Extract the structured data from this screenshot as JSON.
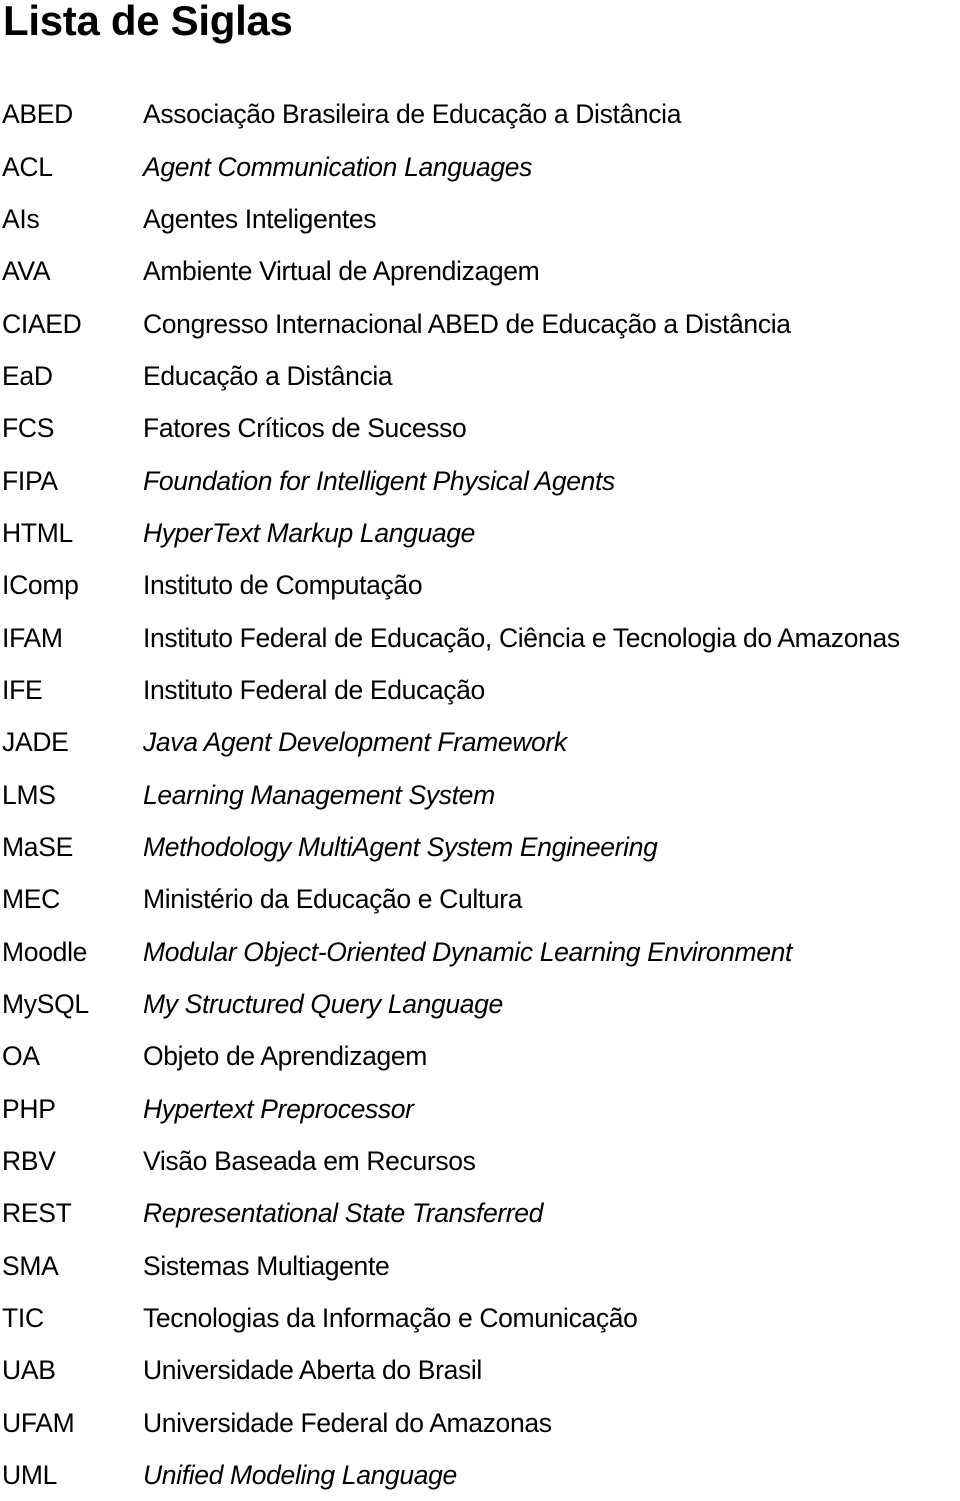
{
  "title": "Lista de Siglas",
  "entries": [
    {
      "abbr": "ABED",
      "definition": "Associação Brasileira de Educação a Distância",
      "italic": false
    },
    {
      "abbr": "ACL",
      "definition": "Agent Communication Languages",
      "italic": true
    },
    {
      "abbr": "AIs",
      "definition": "Agentes Inteligentes",
      "italic": false
    },
    {
      "abbr": "AVA",
      "definition": "Ambiente Virtual de Aprendizagem",
      "italic": false
    },
    {
      "abbr": "CIAED",
      "definition": "Congresso Internacional ABED de Educação a Distância",
      "italic": false
    },
    {
      "abbr": "EaD",
      "definition": "Educação a Distância",
      "italic": false
    },
    {
      "abbr": "FCS",
      "definition": "Fatores Críticos de Sucesso",
      "italic": false
    },
    {
      "abbr": "FIPA",
      "definition": "Foundation for Intelligent Physical Agents",
      "italic": true
    },
    {
      "abbr": "HTML",
      "definition": "HyperText Markup Language",
      "italic": true
    },
    {
      "abbr": "IComp",
      "definition": "Instituto de Computação",
      "italic": false
    },
    {
      "abbr": "IFAM",
      "definition": "Instituto Federal de Educação, Ciência e Tecnologia do Amazonas",
      "italic": false
    },
    {
      "abbr": "IFE",
      "definition": "Instituto Federal de Educação",
      "italic": false
    },
    {
      "abbr": "JADE",
      "definition": "Java Agent Development Framework",
      "italic": true
    },
    {
      "abbr": "LMS",
      "definition": "Learning Management System",
      "italic": true
    },
    {
      "abbr": "MaSE",
      "definition": "Methodology MultiAgent System Engineering",
      "italic": true
    },
    {
      "abbr": "MEC",
      "definition": "Ministério da Educação e Cultura",
      "italic": false
    },
    {
      "abbr": "Moodle",
      "definition": "Modular Object-Oriented Dynamic Learning Environment",
      "italic": true
    },
    {
      "abbr": "MySQL",
      "definition": "My Structured Query Language",
      "italic": true
    },
    {
      "abbr": "OA",
      "definition": "Objeto de Aprendizagem",
      "italic": false
    },
    {
      "abbr": "PHP",
      "definition": "Hypertext Preprocessor",
      "italic": true
    },
    {
      "abbr": "RBV",
      "definition": "Visão Baseada em Recursos",
      "italic": false
    },
    {
      "abbr": "REST",
      "definition": "Representational State Transferred",
      "italic": true
    },
    {
      "abbr": "SMA",
      "definition": "Sistemas Multiagente",
      "italic": false
    },
    {
      "abbr": "TIC",
      "definition": "Tecnologias da Informação e Comunicação",
      "italic": false
    },
    {
      "abbr": "UAB",
      "definition": "Universidade Aberta do Brasil",
      "italic": false
    },
    {
      "abbr": "UFAM",
      "definition": "Universidade Federal do Amazonas",
      "italic": false
    },
    {
      "abbr": "UML",
      "definition": "Unified Modeling Language",
      "italic": true
    }
  ]
}
